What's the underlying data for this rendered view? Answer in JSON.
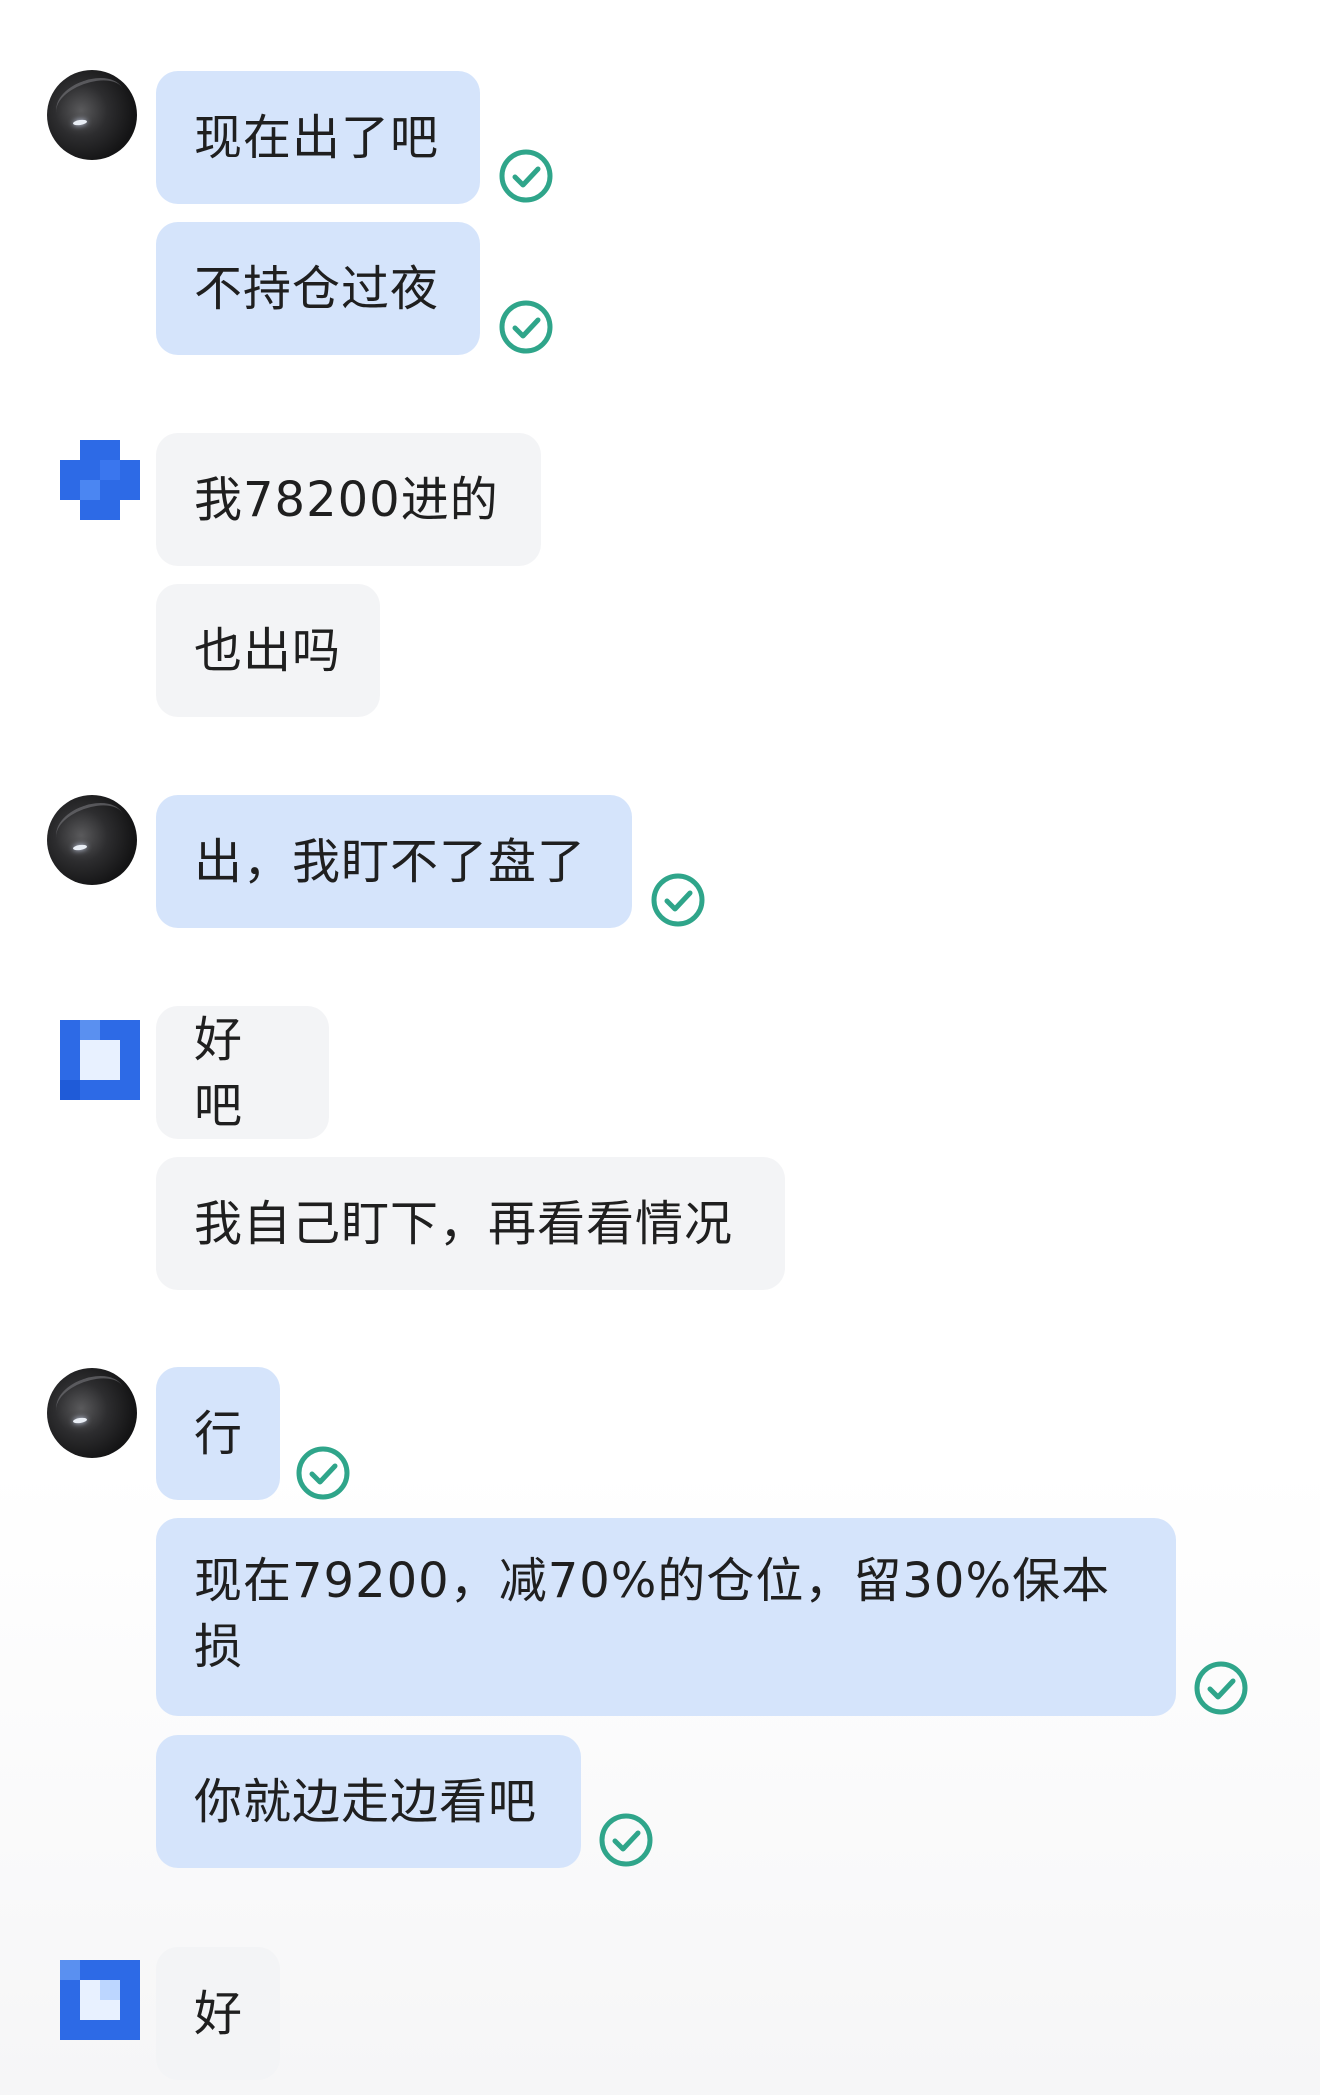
{
  "messages": [
    {
      "side": "me",
      "text": "现在出了吧",
      "read": true
    },
    {
      "side": "me",
      "text": "不持仓过夜",
      "read": true
    },
    {
      "side": "other",
      "text": "我78200进的"
    },
    {
      "side": "other",
      "text": "也出吗"
    },
    {
      "side": "me",
      "text": "出，我盯不了盘了",
      "read": true
    },
    {
      "side": "other",
      "text": "好吧"
    },
    {
      "side": "other",
      "text": "我自己盯下，再看看情况"
    },
    {
      "side": "me",
      "text": "行",
      "read": true
    },
    {
      "side": "me",
      "text": "现在79200，减70%的仓位，留30%保本损",
      "read": true
    },
    {
      "side": "me",
      "text": "你就边走边看吧",
      "read": true
    },
    {
      "side": "other",
      "text": "好"
    }
  ],
  "colors": {
    "sent_bubble": "#d5e4fb",
    "received_bubble": "#f3f4f6",
    "read_check": "#2fa58a",
    "other_avatar": "#2d6ae6"
  },
  "icons": {
    "read_receipt": "check-circle-icon",
    "my_avatar": "dark-anime-avatar",
    "other_avatar": "pixelated-blue-avatar"
  }
}
